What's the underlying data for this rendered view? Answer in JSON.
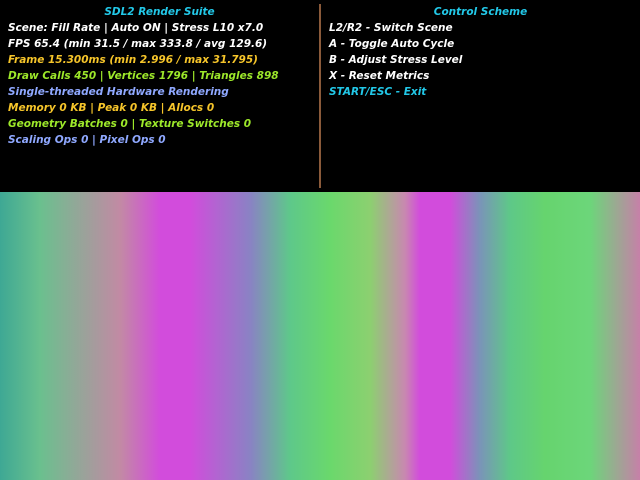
{
  "left_panel": {
    "title": "SDL2 Render Suite",
    "lines": [
      "Scene: Fill Rate | Auto ON | Stress L10 x7.0",
      "FPS 65.4 (min 31.5 / max 333.8 / avg 129.6)",
      "Frame 15.300ms (min 2.996 / max 31.795)",
      "Draw Calls 450 | Vertices 1796 | Triangles 898",
      "Single-threaded Hardware Rendering",
      "Memory 0 KB | Peak 0 KB | Allocs 0",
      "Geometry Batches 0 | Texture Switches 0",
      "Scaling Ops 0 | Pixel Ops 0"
    ]
  },
  "right_panel": {
    "title": "Control Scheme",
    "lines": [
      "L2/R2 - Switch Scene",
      "A - Toggle Auto Cycle",
      "B - Adjust Stress Level",
      "X - Reset Metrics",
      "START/ESC - Exit"
    ]
  },
  "colors": {
    "title": "#22c8e8",
    "white": "#ffffff",
    "yellow": "#f6c52a",
    "green": "#9de82a",
    "blue": "#8fa8ff",
    "divider": "#8a5a3a",
    "scene_green": "#6ad86c",
    "scene_magenta": "#d24cdc"
  }
}
